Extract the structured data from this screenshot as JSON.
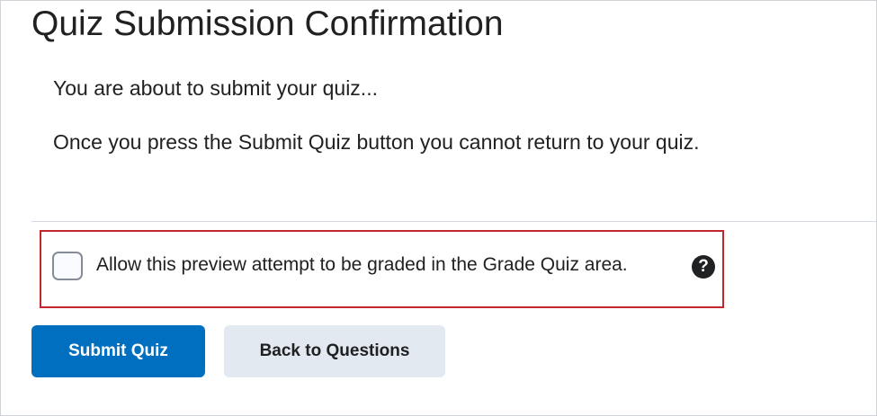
{
  "page": {
    "title": "Quiz Submission Confirmation",
    "intro": "You are about to submit your quiz...",
    "warning": "Once you press the Submit Quiz button you cannot return to your quiz."
  },
  "grading_option": {
    "checked": false,
    "label": "Allow this preview attempt to be graded in the Grade Quiz area.",
    "help_icon": "question-circle-icon",
    "help_glyph": "?"
  },
  "actions": {
    "submit_label": "Submit Quiz",
    "back_label": "Back to Questions"
  },
  "colors": {
    "primary_button": "#006fbf",
    "secondary_button": "#e3e9f1",
    "highlight_border": "#c0282d"
  }
}
